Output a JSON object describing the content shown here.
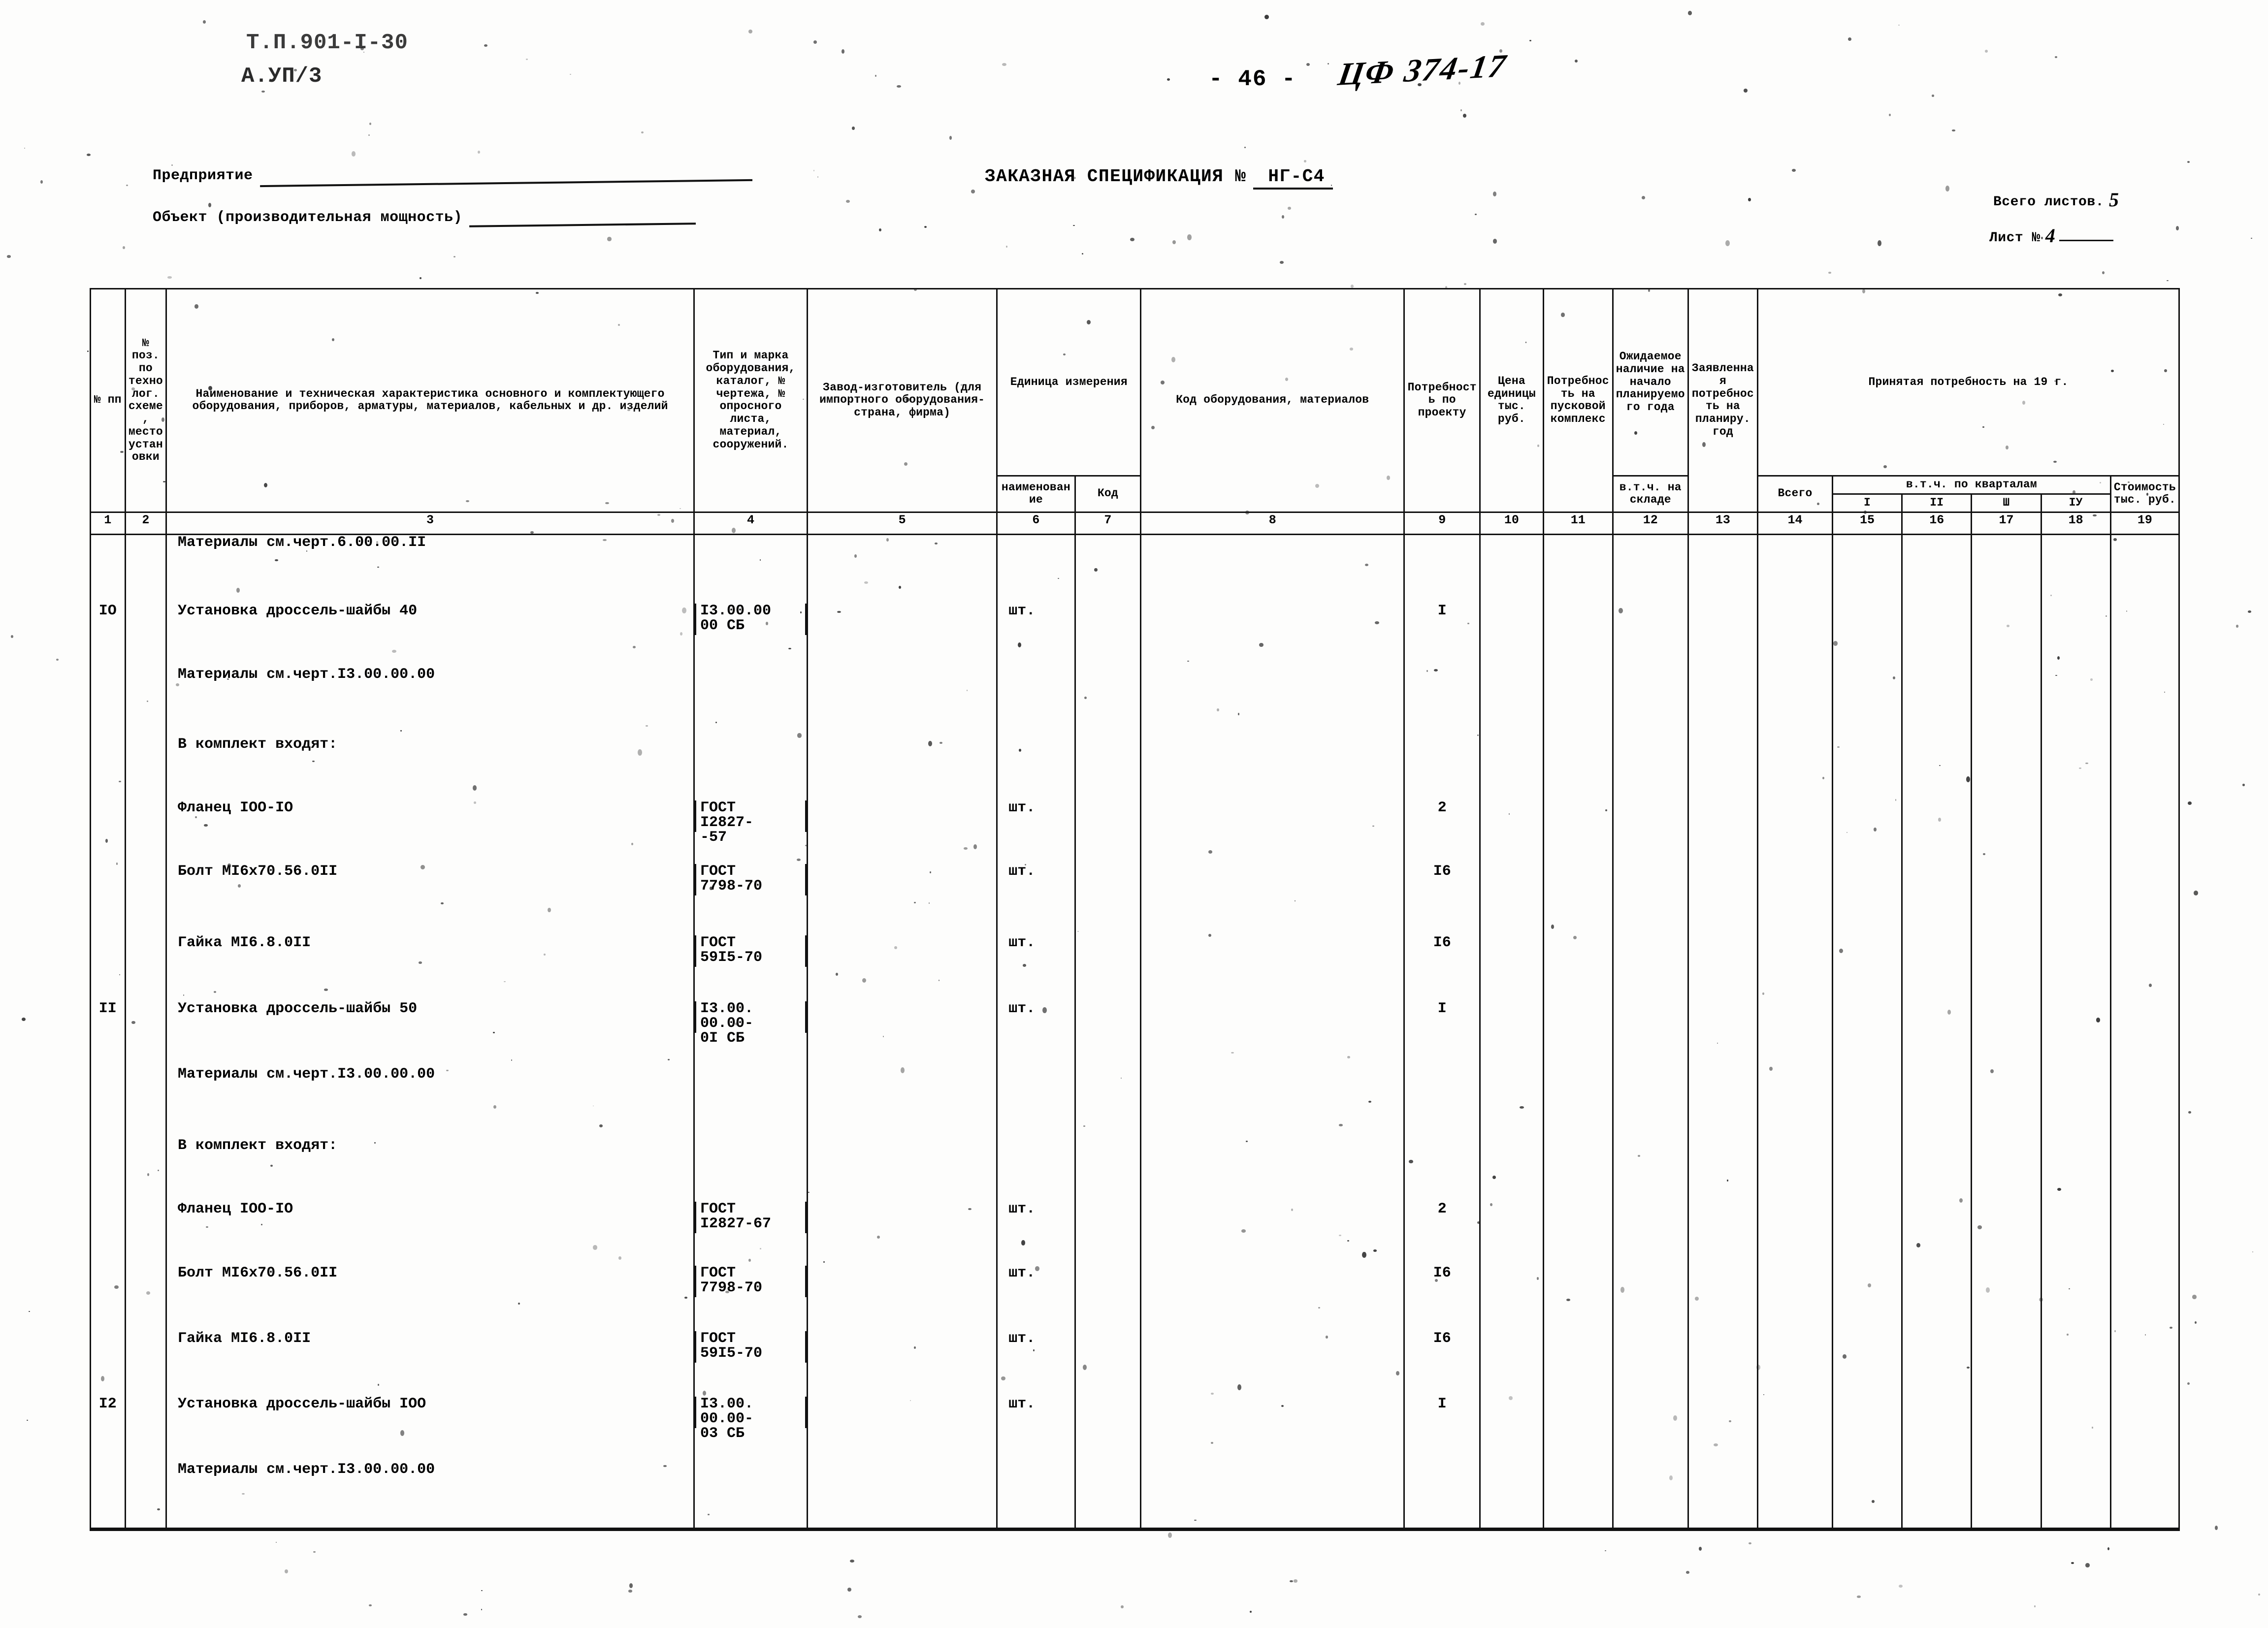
{
  "header": {
    "code_line1": "Т.П.901-I-30",
    "code_line2": "А.УП/3",
    "page_number": "- 46 -",
    "hand_mark": "ЦФ 374-17",
    "enterprise_label": "Предприятие",
    "object_label": "Объект (производительная мощность)",
    "spec_title": "ЗАКАЗНАЯ СПЕЦИФИКАЦИЯ №",
    "spec_number": "НГ-С4",
    "sheets_total_label": "Всего листов.",
    "sheets_total_value": "5",
    "sheet_no_label": "Лист №",
    "sheet_no_value": "4"
  },
  "table": {
    "headers": {
      "col1": "№ пп",
      "col2": "№ поз. по технолог. схеме, место установки",
      "col3": "Наименование и техническая характеристика основного и комплектующего оборудования, приборов, арматуры, материалов, кабельных и др. изделий",
      "col4": "Тип и марка оборудования, каталог, № чертежа, № опросного листа, материал, сооружений.",
      "col5": "Завод-изготовитель (для импортного оборудования- страна, фирма)",
      "col6_group": "Единица измерения",
      "col6": "наименование",
      "col7": "Код",
      "col8": "Код оборудования, материалов",
      "col9": "Потребность по проекту",
      "col10": "Цена единицы тыс. руб.",
      "col11": "Потребность на пусковой комплекс",
      "col12": "Ожидаемое наличие на начало планируемого года",
      "col12b": "в.т.ч. на складе",
      "col13": "Заявленная потребность на планиру. год",
      "col14_group": "Принятая потребность на 19          г.",
      "col14": "Всего",
      "col15_group": "в.т.ч. по кварталам",
      "col15": "I",
      "col16": "II",
      "col17": "Ш",
      "col18": "IУ",
      "col19": "Стоимость тыс. руб."
    },
    "column_numbers": [
      "1",
      "2",
      "3",
      "4",
      "5",
      "6",
      "7",
      "8",
      "9",
      "10",
      "11",
      "12",
      "13",
      "14",
      "15",
      "16",
      "17",
      "18",
      "19"
    ],
    "rows": [
      {
        "pos": "",
        "no": "",
        "name": "Материалы см.черт.6.00.00.II",
        "type": "",
        "unit": "",
        "qty": ""
      },
      {
        "pos": "IO",
        "no": "",
        "name": "Установка дроссель-шайбы 40",
        "type": "I3.00.00\n00 СБ",
        "unit": "шт.",
        "qty": "I"
      },
      {
        "pos": "",
        "no": "",
        "name": "Материалы см.черт.I3.00.00.00",
        "type": "",
        "unit": "",
        "qty": ""
      },
      {
        "pos": "",
        "no": "",
        "name": "В комплект входят:",
        "type": "",
        "unit": "",
        "qty": ""
      },
      {
        "pos": "",
        "no": "",
        "name": "Фланец IOO-IO",
        "type": "ГОСТ\nI2827-\n-57",
        "unit": "шт.",
        "qty": "2"
      },
      {
        "pos": "",
        "no": "",
        "name": "Болт MI6x70.56.0II",
        "type": "ГОСТ\n7798-70",
        "unit": "шт.",
        "qty": "I6"
      },
      {
        "pos": "",
        "no": "",
        "name": "Гайка MI6.8.0II",
        "type": "ГОСТ\n59I5-70",
        "unit": "шт.",
        "qty": "I6"
      },
      {
        "pos": "II",
        "no": "",
        "name": "Установка дроссель-шайбы 50",
        "type": "I3.00.\n00.00-\n0I СБ",
        "unit": "шт.",
        "qty": "I"
      },
      {
        "pos": "",
        "no": "",
        "name": "Материалы см.черт.I3.00.00.00",
        "type": "",
        "unit": "",
        "qty": ""
      },
      {
        "pos": "",
        "no": "",
        "name": "В комплект входят:",
        "type": "",
        "unit": "",
        "qty": ""
      },
      {
        "pos": "",
        "no": "",
        "name": "Фланец IOO-IO",
        "type": "ГОСТ\nI2827-67",
        "unit": "шт.",
        "qty": "2"
      },
      {
        "pos": "",
        "no": "",
        "name": "Болт MI6x70.56.0II",
        "type": "ГОСТ\n7798-70",
        "unit": "шт.",
        "qty": "I6"
      },
      {
        "pos": "",
        "no": "",
        "name": "Гайка MI6.8.0II",
        "type": "ГОСТ\n59I5-70",
        "unit": "шт.",
        "qty": "I6"
      },
      {
        "pos": "I2",
        "no": "",
        "name": "Установка дроссель-шайбы IOO",
        "type": "I3.00.\n00.00-\n03 СБ",
        "unit": "шт.",
        "qty": "I"
      },
      {
        "pos": "",
        "no": "",
        "name": "Материалы см.черт.I3.00.00.00",
        "type": "",
        "unit": "",
        "qty": ""
      }
    ]
  }
}
